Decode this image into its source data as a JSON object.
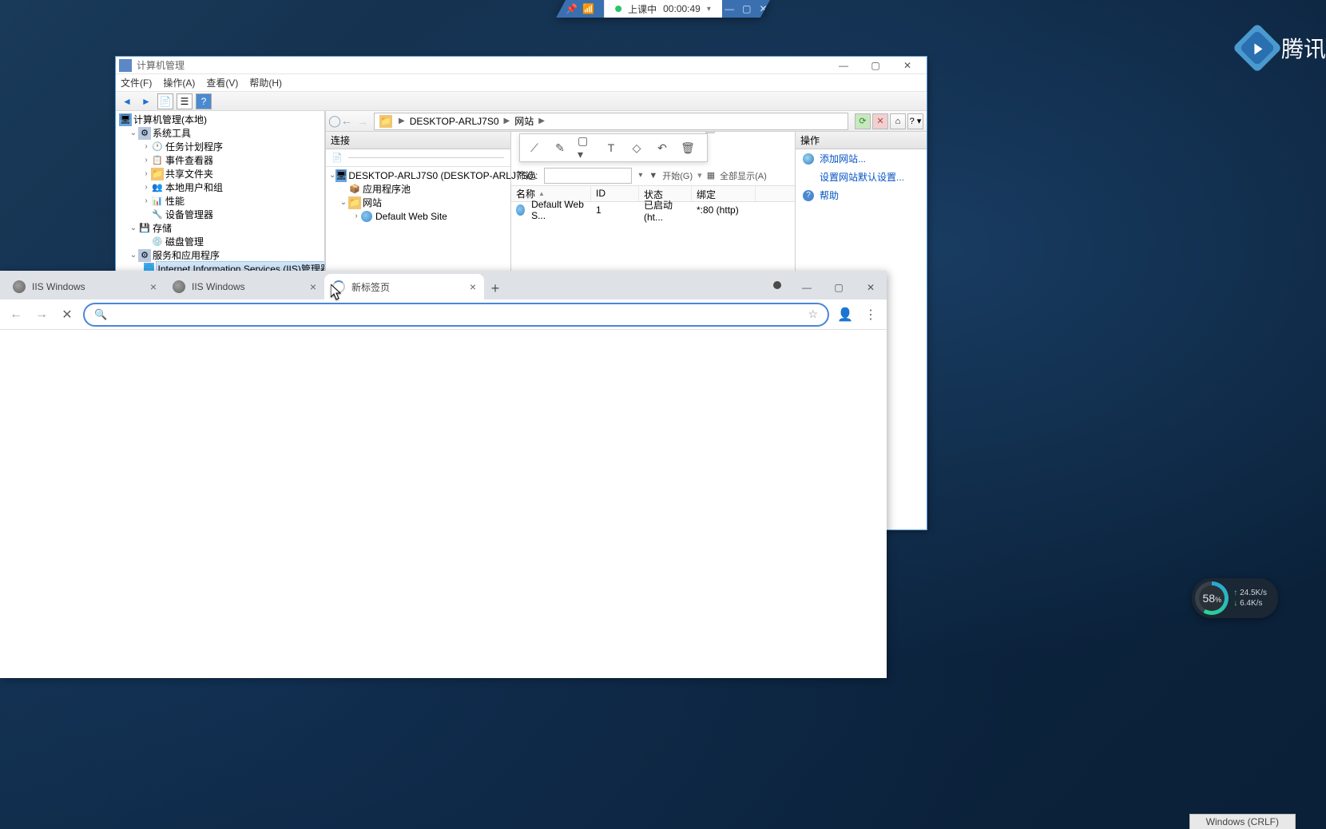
{
  "top_bar": {
    "status_text": "上课中",
    "timer": "00:00:49"
  },
  "tencent_logo_text": "腾讯",
  "mmc": {
    "title": "计算机管理",
    "menu": {
      "file": "文件(F)",
      "action": "操作(A)",
      "view": "查看(V)",
      "help": "帮助(H)"
    },
    "tree": {
      "root": "计算机管理(本地)",
      "system_tools": "系统工具",
      "task_scheduler": "任务计划程序",
      "event_viewer": "事件查看器",
      "shared_folders": "共享文件夹",
      "local_users": "本地用户和组",
      "performance": "性能",
      "device_manager": "设备管理器",
      "storage": "存储",
      "disk_mgmt": "磁盘管理",
      "services_apps": "服务和应用程序",
      "iis_mgr": "Internet Information Services (IIS)管理器"
    }
  },
  "iis": {
    "breadcrumb": {
      "server": "DESKTOP-ARLJ7S0",
      "sites": "网站"
    },
    "conn_header": "连接",
    "conn_tree": {
      "server": "DESKTOP-ARLJ7S0 (DESKTOP-ARLJ7S0\\",
      "app_pools": "应用程序池",
      "sites": "网站",
      "default_site": "Default Web Site"
    },
    "filter": {
      "label": "筛选:",
      "start": "开始(G)",
      "show_all": "全部显示(A)"
    },
    "grid": {
      "col_name": "名称",
      "col_id": "ID",
      "col_status": "状态",
      "col_binding": "绑定",
      "row_name": "Default Web S...",
      "row_id": "1",
      "row_status": "已启动 (ht...",
      "row_binding": "*:80 (http)"
    },
    "actions": {
      "header": "操作",
      "add_site": "添加网站...",
      "set_defaults": "设置网站默认设置...",
      "help": "帮助"
    }
  },
  "chrome": {
    "tabs": {
      "t1": "IIS Windows",
      "t2": "IIS Windows",
      "t3": "新标签页"
    },
    "address": ""
  },
  "net": {
    "pct": "58",
    "pct_unit": "%",
    "up": "24.5",
    "up_unit": "K/s",
    "dn": "6.4",
    "dn_unit": "K/s"
  },
  "status_bar": "Windows (CRLF)"
}
